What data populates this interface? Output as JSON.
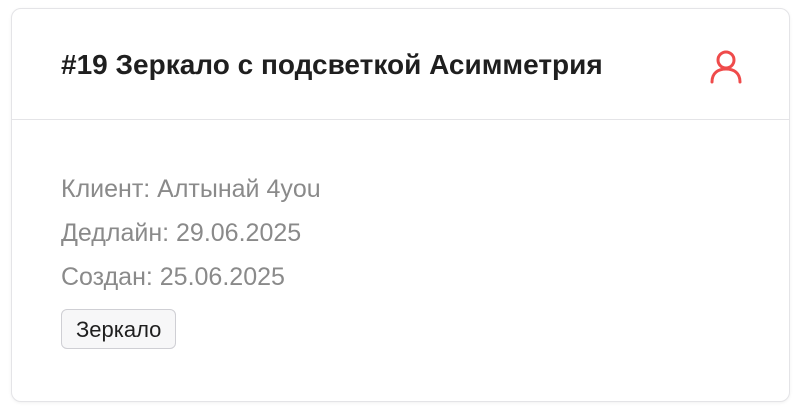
{
  "card": {
    "title": "#19 Зеркало с подсветкой Асимметрия",
    "icon": "user-icon",
    "accent_color": "#ef4b4b",
    "meta": {
      "client": "Клиент: Алтынай 4you",
      "deadline": "Дедлайн: 29.06.2025",
      "created": "Создан: 25.06.2025"
    },
    "tag": "Зеркало"
  }
}
